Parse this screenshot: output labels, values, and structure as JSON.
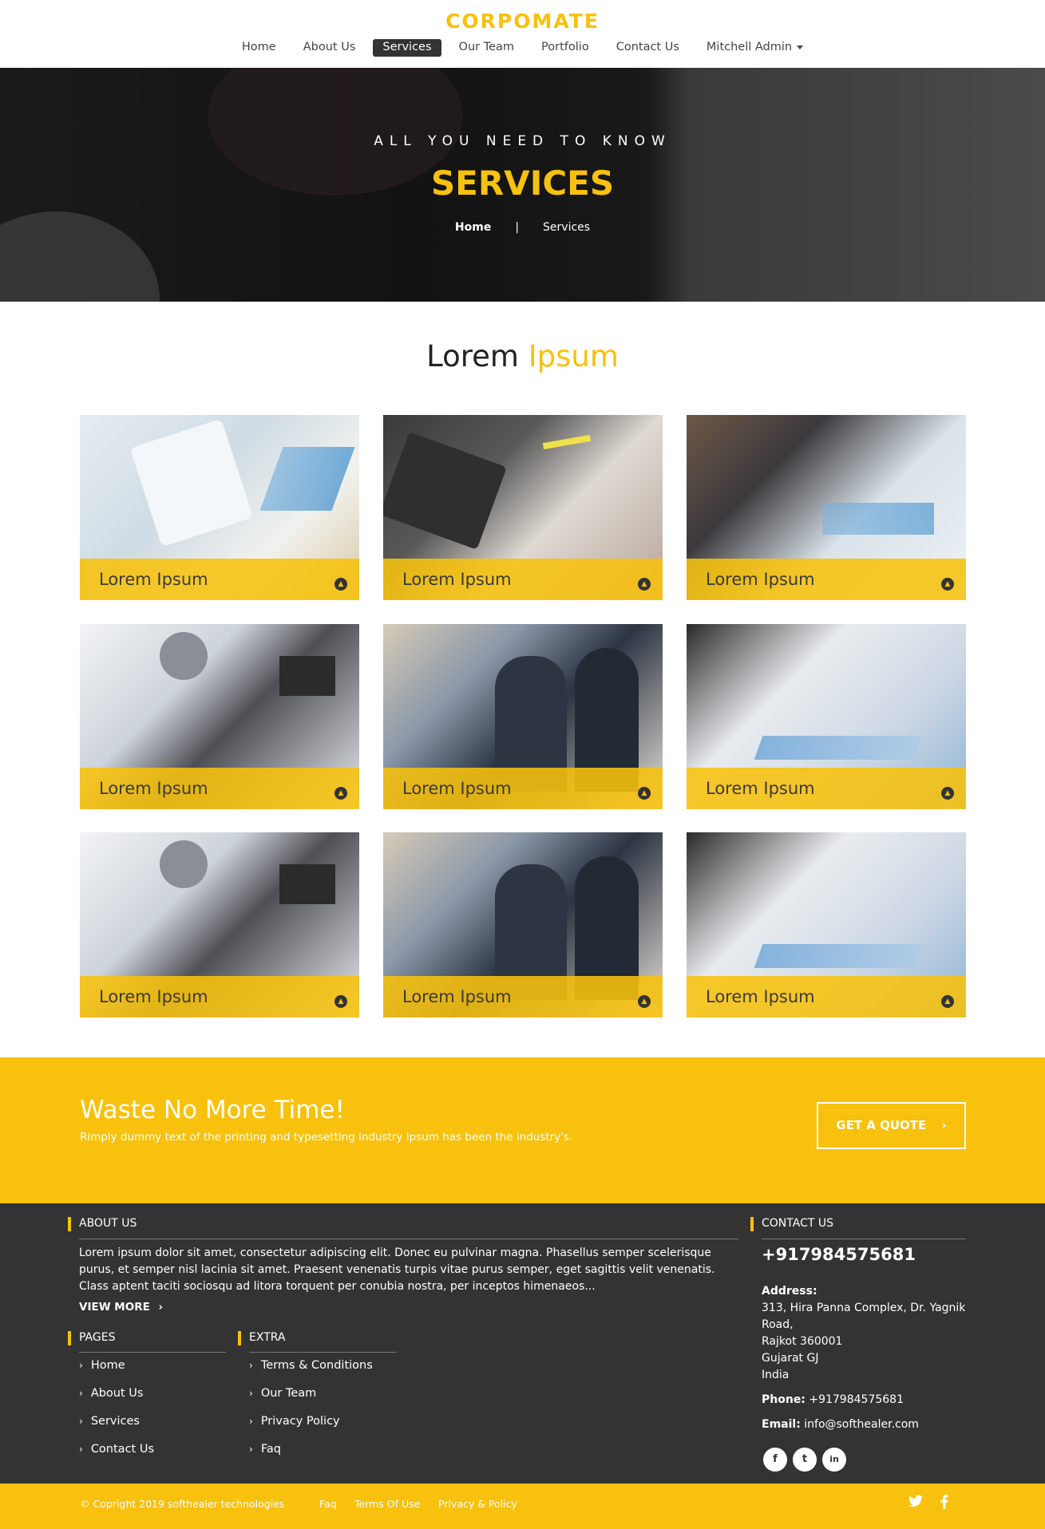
{
  "brand": {
    "logo": "CORPOMATE",
    "accent": "#f7c10d"
  },
  "nav": {
    "items": [
      "Home",
      "About Us",
      "Services",
      "Our Team",
      "Portfolio",
      "Contact Us",
      "Mitchell Admin"
    ],
    "active": "Services"
  },
  "hero": {
    "kicker": "ALL YOU NEED TO KNOW",
    "title": "SERVICES",
    "breadcrumb_home": "Home",
    "breadcrumb_sep": "|",
    "breadcrumb_current": "Services"
  },
  "section": {
    "title_part1": "Lorem",
    "title_part2": "Ipsum"
  },
  "cards": [
    {
      "label": "Lorem Ipsum",
      "icon": "chevron-up-circle-icon"
    },
    {
      "label": "Lorem Ipsum",
      "icon": "chevron-up-circle-icon"
    },
    {
      "label": "Lorem Ipsum",
      "icon": "chevron-up-circle-icon"
    },
    {
      "label": "Lorem Ipsum",
      "icon": "chevron-up-circle-icon"
    },
    {
      "label": "Lorem Ipsum",
      "icon": "chevron-up-circle-icon"
    },
    {
      "label": "Lorem Ipsum",
      "icon": "chevron-up-circle-icon"
    },
    {
      "label": "Lorem Ipsum",
      "icon": "chevron-up-circle-icon"
    },
    {
      "label": "Lorem Ipsum",
      "icon": "chevron-up-circle-icon"
    },
    {
      "label": "Lorem Ipsum",
      "icon": "chevron-up-circle-icon"
    }
  ],
  "cta": {
    "title": "Waste No More Time!",
    "text": "Rimply dummy text of the printing and typesetting industry Ipsum has been the industry's.",
    "button": "GET A QUOTE",
    "button_icon": "›"
  },
  "footer": {
    "about_head": "ABOUT US",
    "about_text": "Lorem ipsum dolor sit amet, consectetur adipiscing elit. Donec eu pulvinar magna. Phasellus semper scelerisque purus, et semper nisl lacinia sit amet. Praesent venenatis turpis vitae purus semper, eget sagittis velit venenatis. Class aptent taciti sociosqu ad litora torquent per conubia nostra, per inceptos himenaeos...",
    "view_more": "VIEW MORE",
    "view_more_icon": "›",
    "pages_head": "PAGES",
    "pages": [
      "Home",
      "About Us",
      "Services",
      "Contact Us"
    ],
    "extra_head": "EXTRA",
    "extra": [
      "Terms & Conditions",
      "Our Team",
      "Privacy Policy",
      "Faq"
    ],
    "link_chevron": "›",
    "contact_head": "CONTACT US",
    "phone_big": "+917984575681",
    "address_label": "Address:",
    "address_lines": [
      "313, Hira Panna Complex, Dr. Yagnik",
      "Road,",
      "Rajkot 360001",
      "Gujarat GJ",
      "India"
    ],
    "phone_label": "Phone:",
    "phone": "+917984575681",
    "email_label": "Email:",
    "email": "info@softhealer.com",
    "social": [
      "f",
      "t",
      "in"
    ]
  },
  "bottom": {
    "copyright": "© Copright 2019 softhealer technologies",
    "links": [
      "Faq",
      "Terms Of Use",
      "Privacy & Policy"
    ],
    "icons": [
      "twitter-icon",
      "facebook-icon"
    ]
  }
}
